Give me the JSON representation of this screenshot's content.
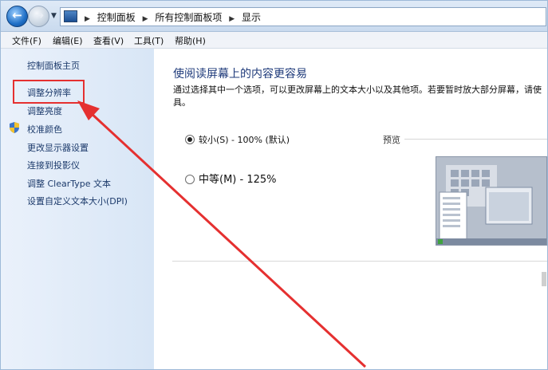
{
  "address": {
    "crumbs": [
      "控制面板",
      "所有控制面板项",
      "显示"
    ]
  },
  "menu": [
    "文件(F)",
    "编辑(E)",
    "查看(V)",
    "工具(T)",
    "帮助(H)"
  ],
  "sidebar": {
    "home": "控制面板主页",
    "items": [
      "调整分辨率",
      "调整亮度",
      "校准颜色",
      "更改显示器设置",
      "连接到投影仪",
      "调整 ClearType 文本",
      "设置自定义文本大小(DPI)"
    ]
  },
  "main": {
    "title": "使阅读屏幕上的内容更容易",
    "description_line1": "通过选择其中一个选项，可以更改屏幕上的文本大小以及其他项。若要暂时放大部分屏幕，请使",
    "description_line2": "具。",
    "options": [
      {
        "label": "较小(S) - 100% (默认)",
        "selected": true
      },
      {
        "label": "中等(M) - 125%",
        "selected": false
      }
    ],
    "preview_label": "预览"
  },
  "annotation": {
    "highlight_color": "#e53030"
  }
}
